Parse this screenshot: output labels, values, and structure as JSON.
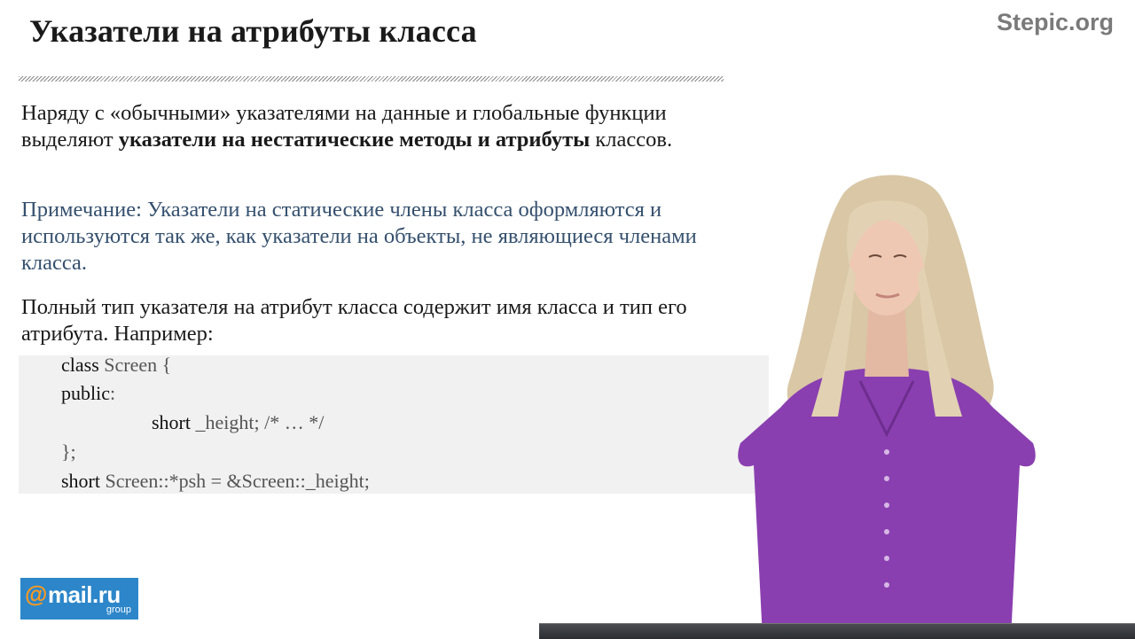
{
  "header": {
    "title": "Указатели на атрибуты класса",
    "brand": "Stepic.org"
  },
  "content": {
    "p1_text_a": "Наряду с «обычными» указателями на данные и глобальные функции выделяют ",
    "p1_bold": "указатели на нестатические методы и атрибуты",
    "p1_text_b": " классов.",
    "note": "Примечание: Указатели на статические члены класса оформляются и используются так же, как указатели на объекты, не являющиеся членами класса.",
    "p3": "Полный тип указателя на атрибут класса содержит имя класса и тип его атрибута. Например:"
  },
  "code": {
    "l1_kw": "class",
    "l1_rest": " Screen {",
    "l2_kw": "public",
    "l2_rest": ":",
    "l3_kw": "short",
    "l3_rest": " _height; /* … */",
    "l4": "};",
    "l5_kw": "short",
    "l5_rest": " Screen::*psh = &Screen::_height;"
  },
  "logo": {
    "at": "@",
    "word": "mail.ru",
    "group": "group"
  },
  "colors": {
    "note_text": "#35506e",
    "code_bg": "#f1f1f1",
    "logo_bg": "#2c86c9",
    "blouse": "#8a3fb0"
  }
}
